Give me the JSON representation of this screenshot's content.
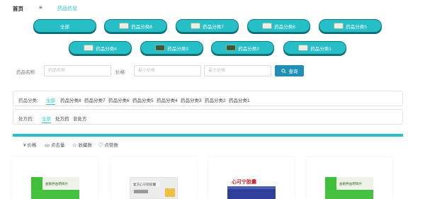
{
  "nav": {
    "home": "首页",
    "menu_icon": "≡",
    "breadcrumb": "药品信息"
  },
  "categories": [
    {
      "label": "全部"
    },
    {
      "label": "药品分类8"
    },
    {
      "label": "药品分类7"
    },
    {
      "label": "药品分类6"
    },
    {
      "label": "药品分类5"
    },
    {
      "label": "药品分类4"
    },
    {
      "label": "药品分类3"
    },
    {
      "label": "药品分类2"
    },
    {
      "label": "药品分类1"
    }
  ],
  "search": {
    "name_label": "药品名称:",
    "name_placeholder": "药品名称",
    "price_label": "价格:",
    "min_placeholder": "最小价格",
    "max_placeholder": "最大价格",
    "button": "查询"
  },
  "filter_category": {
    "title": "药品分类:",
    "options": [
      "全部",
      "药品分类8",
      "药品分类7",
      "药品分类6",
      "药品分类5",
      "药品分类4",
      "药品分类3",
      "药品分类2",
      "药品分类1"
    ]
  },
  "filter_rx": {
    "title": "处方药:",
    "options": [
      "全部",
      "处方药",
      "非处方"
    ]
  },
  "sort": {
    "price": "¥ 价格",
    "clicks": "点击量",
    "favorites": "收藏数",
    "likes": "点赞数"
  },
  "products": [
    {
      "box_text": "益眼养血明目片"
    },
    {
      "box_text": "复方心宁软胶囊"
    },
    {
      "box_text": "心可宁胶囊"
    },
    {
      "box_text": "益眼养血明目片"
    }
  ],
  "colors": {
    "accent": "#26bfc8",
    "button": "#1f8fb8"
  }
}
